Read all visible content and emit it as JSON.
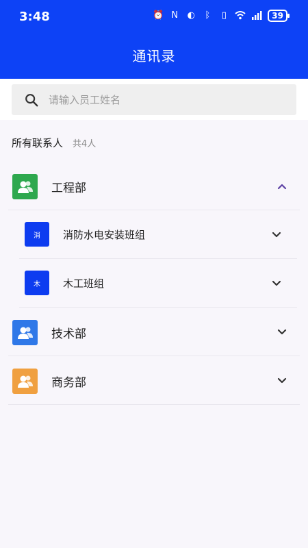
{
  "status_bar": {
    "time": "3:48",
    "battery": "39",
    "icons": [
      "alarm-clock-icon",
      "nfc-icon",
      "do-not-disturb-icon",
      "bluetooth-icon",
      "vibrate-icon",
      "wifi-icon",
      "signal-icon"
    ]
  },
  "header": {
    "title": "通讯录",
    "background": "#0d42f6"
  },
  "search": {
    "placeholder": "请输入员工姓名"
  },
  "summary": {
    "title": "所有联系人",
    "count": "共4人"
  },
  "departments": [
    {
      "name": "工程部",
      "icon_color": "#2ea84e",
      "expanded": true,
      "teams": [
        {
          "name": "消防水电安装班组",
          "badge": "消"
        },
        {
          "name": "木工班组",
          "badge": "木"
        }
      ]
    },
    {
      "name": "技术部",
      "icon_color": "#2f78e8",
      "expanded": false
    },
    {
      "name": "商务部",
      "icon_color": "#f0a040",
      "expanded": false
    }
  ]
}
